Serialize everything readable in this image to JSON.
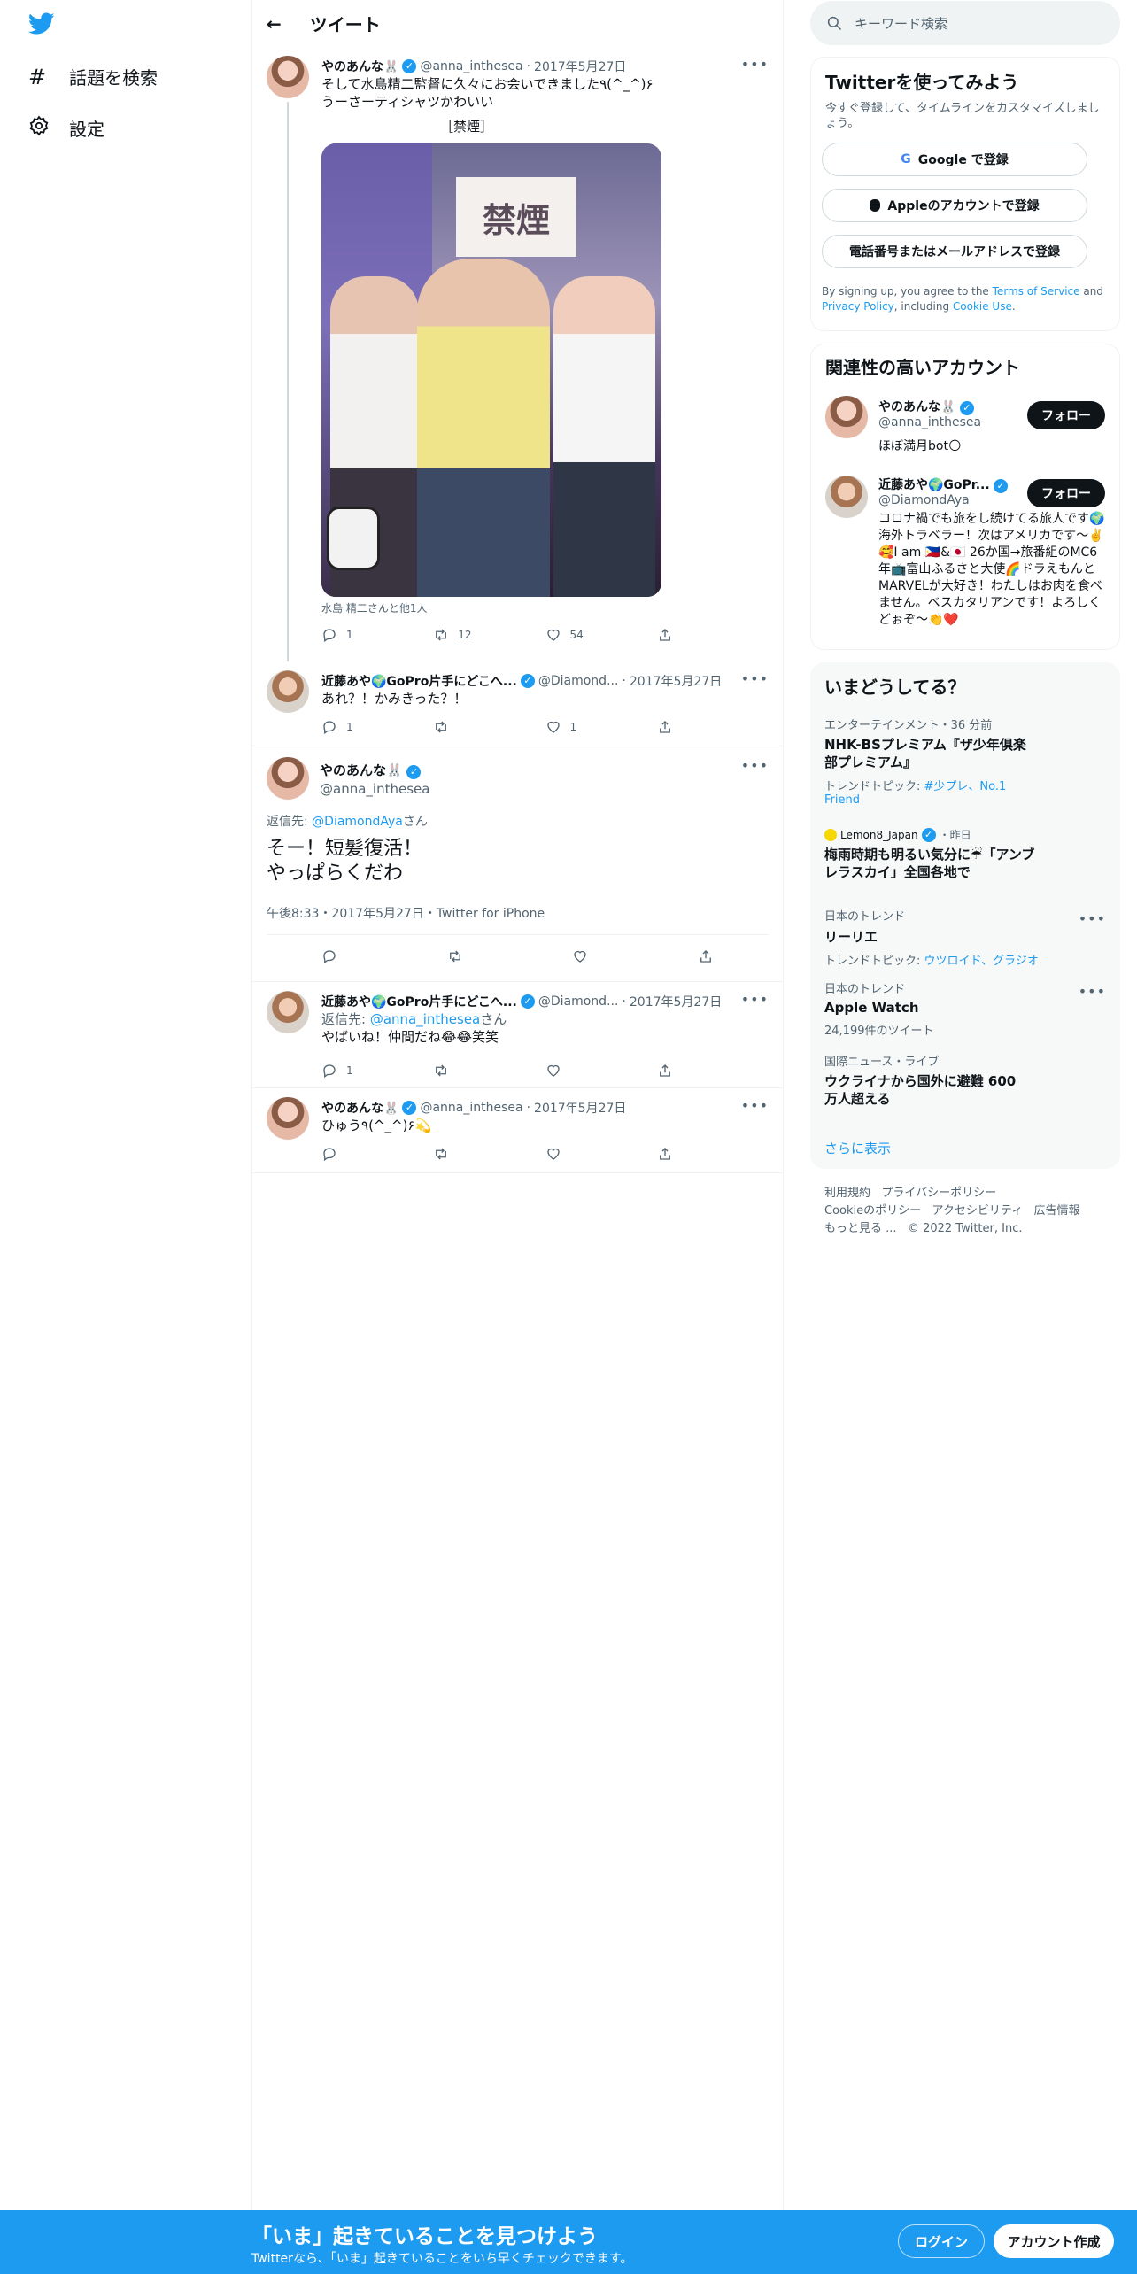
{
  "nav": {
    "explore": "話題を検索",
    "settings": "設定"
  },
  "header": {
    "title": "ツイート"
  },
  "tweets": [
    {
      "name": "やのあんな🐰",
      "handle": "@anna_inthesea",
      "date": "2017年5月27日",
      "text1": "そして水島精二監督に久々にお会いできました٩(^_^)۶",
      "text2": "うーさーティシャツかわいい",
      "caption": "［禁煙］",
      "sign": "禁煙",
      "tagged": "水島 精二さんと他1人",
      "reply": "1",
      "retweet": "12",
      "like": "54"
    },
    {
      "name": "近藤あや🌍GoPro片手にどこへ...",
      "handle": "@Diamond...",
      "date": "2017年5月27日",
      "text": "あれ？！かみきった？！",
      "reply": "1",
      "retweet": "",
      "like": "1"
    }
  ],
  "focus": {
    "name": "やのあんな🐰",
    "handle": "@anna_inthesea",
    "reply_prefix": "返信先: ",
    "reply_to": "@DiamondAya",
    "reply_suffix": "さん",
    "line1": "そー！短髪復活！",
    "line2": "やっぱらくだわ",
    "meta": "午後8:33・2017年5月27日・Twitter for iPhone"
  },
  "replies": [
    {
      "name": "近藤あや🌍GoPro片手にどこへ...",
      "handle": "@Diamond...",
      "date": "2017年5月27日",
      "reply_prefix": "返信先: ",
      "reply_to": "@anna_inthesea",
      "reply_suffix": "さん",
      "text": "やばいね！仲間だね😂😂笑笑",
      "reply": "1"
    },
    {
      "name": "やのあんな🐰",
      "handle": "@anna_inthesea",
      "date": "2017年5月27日",
      "text": "ひゅう٩(^_^)۶💫"
    }
  ],
  "search": {
    "placeholder": "キーワード検索"
  },
  "signup": {
    "title": "Twitterを使ってみよう",
    "sub": "今すぐ登録して、タイムラインをカスタマイズしましょう。",
    "google": "Google で登録",
    "apple": "Appleのアカウントで登録",
    "phone": "電話番号またはメールアドレスで登録",
    "legal1": "By signing up, you agree to the ",
    "tos": "Terms of Service",
    "and": " and",
    "privacy": "Privacy Policy",
    "legal2": ", including ",
    "cookie": "Cookie Use",
    "dot": "."
  },
  "related": {
    "title": "関連性の高いアカウント",
    "follow": "フォロー",
    "a1": {
      "name": "やのあんな🐰",
      "handle": "@anna_inthesea",
      "bio": "ほぼ満月bot🌕"
    },
    "a2": {
      "name": "近藤あや🌍GoPr...",
      "handle": "@DiamondAya",
      "bio": "コロナ禍でも旅をし続けてる旅人です🌍海外トラベラー！次はアメリカです〜✌️🥰I am 🇵🇭&🇯🇵 26か国→旅番組のMC6年📺富山ふるさと大使🌈ドラえもんとMARVELが大好き！わたしはお肉を食べません。ベスカタリアンです！よろしくどぉぞ〜👏❤️"
    }
  },
  "trends": {
    "title": "いまどうしてる？",
    "more": "さらに表示",
    "t1": {
      "cat": "エンターテインメント・36 分前",
      "name": "NHK-BSプレミアム『ザ少年倶楽部プレミアム』",
      "topic_label": "トレンドトピック: ",
      "topic": "#少プレ、No.1 Friend"
    },
    "t2": {
      "src": "Lemon8_Japan",
      "time": "・昨日",
      "name": "梅雨時期も明るい気分に☔「アンブレラスカイ」全国各地で"
    },
    "t3": {
      "cat": "日本のトレンド",
      "name": "リーリエ",
      "topic_label": "トレンドトピック: ",
      "topic": "ウツロイド、グラジオ"
    },
    "t4": {
      "cat": "日本のトレンド",
      "name": "Apple Watch",
      "count": "24,199件のツイート"
    },
    "t5": {
      "cat": "国際ニュース・ライブ",
      "name": "ウクライナから国外に避難 600万人超える"
    }
  },
  "footer": {
    "l1": "利用規約",
    "l2": "プライバシーポリシー",
    "l3": "Cookieのポリシー",
    "l4": "アクセシビリティ",
    "l5": "広告情報",
    "l6": "もっと見る ...",
    "copy": "© 2022 Twitter, Inc."
  },
  "banner": {
    "title": "「いま」起きていることを見つけよう",
    "sub": "Twitterなら、「いま」起きていることをいち早くチェックできます。",
    "login": "ログイン",
    "signup": "アカウント作成"
  }
}
